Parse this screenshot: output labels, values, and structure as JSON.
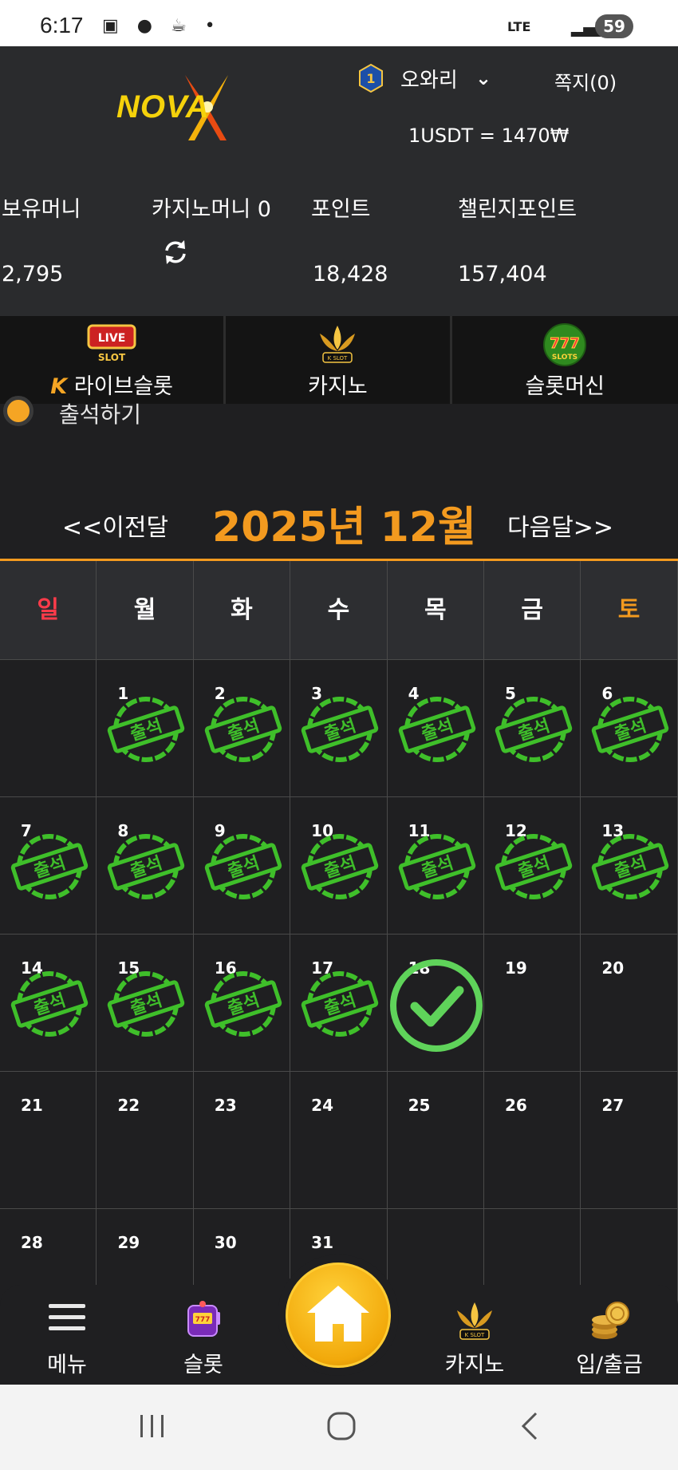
{
  "status_bar": {
    "time": "6:17",
    "network": "LTE",
    "battery": "59"
  },
  "header": {
    "logo_text": "NOVA",
    "username": "오와리",
    "level": "1",
    "messages": "쪽지(0)",
    "rate": "1USDT = 1470₩"
  },
  "balances": [
    {
      "label": "보유머니",
      "value": "2,795"
    },
    {
      "label": "카지노머니 0",
      "value": ""
    },
    {
      "label": "포인트",
      "value": "18,428"
    },
    {
      "label": "챌린지포인트",
      "value": "157,404"
    }
  ],
  "tabs": [
    {
      "label": "라이브슬롯",
      "icon": "live-slot-icon"
    },
    {
      "label": "카지노",
      "icon": "kslot-icon"
    },
    {
      "label": "슬롯머신",
      "icon": "777-slots-icon"
    }
  ],
  "attendance": {
    "label": "출석하기"
  },
  "calendar": {
    "prev": "<<이전달",
    "title": "2025년 12월",
    "next": "다음달>>",
    "weekdays": [
      "일",
      "월",
      "화",
      "수",
      "목",
      "금",
      "토"
    ],
    "stamp_text": "출석",
    "weeks": [
      [
        "",
        "1",
        "2",
        "3",
        "4",
        "5",
        "6"
      ],
      [
        "7",
        "8",
        "9",
        "10",
        "11",
        "12",
        "13"
      ],
      [
        "14",
        "15",
        "16",
        "17",
        "18",
        "19",
        "20"
      ],
      [
        "21",
        "22",
        "23",
        "24",
        "25",
        "26",
        "27"
      ],
      [
        "28",
        "29",
        "30",
        "31",
        "",
        "",
        ""
      ]
    ],
    "attended_days": [
      "1",
      "2",
      "3",
      "4",
      "5",
      "6",
      "7",
      "8",
      "9",
      "10",
      "11",
      "12",
      "13",
      "14",
      "15",
      "16",
      "17"
    ],
    "today": "18"
  },
  "bottom_nav": [
    {
      "label": "메뉴",
      "icon": "hamburger-icon"
    },
    {
      "label": "슬롯",
      "icon": "slot-machine-icon"
    },
    {
      "label": "",
      "icon": "home-icon"
    },
    {
      "label": "카지노",
      "icon": "kslot-icon"
    },
    {
      "label": "입/출금",
      "icon": "coins-icon"
    }
  ],
  "colors": {
    "accent": "#f39a1f",
    "sunday": "#ff3b4a",
    "stamp": "#3fbf2a",
    "panel": "#2a2b2d"
  }
}
